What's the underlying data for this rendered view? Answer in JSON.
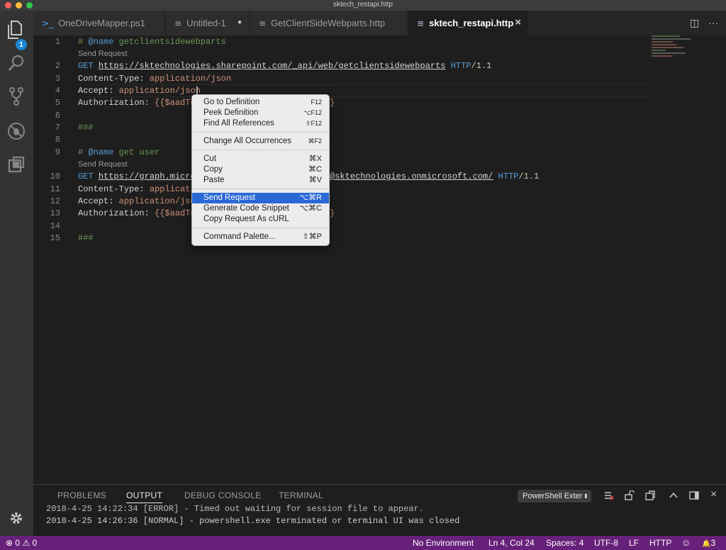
{
  "window": {
    "title": "sktech_restapi.http"
  },
  "activity": {
    "explorer_badge": "1"
  },
  "tabs": [
    {
      "label": "OneDriveMapper.ps1",
      "icon": "powershell-file-icon"
    },
    {
      "label": "Untitled-1",
      "icon": "file-icon",
      "dirty": true
    },
    {
      "label": "GetClientSideWebparts.http",
      "icon": "file-icon"
    },
    {
      "label": "sktech_restapi.http",
      "icon": "file-icon",
      "active": true
    }
  ],
  "glyphs": {
    "ps": ">_",
    "doc": "≡",
    "dot": "●",
    "close": "×",
    "split": "◫",
    "more": "···"
  },
  "editor": {
    "code_lens": "Send Request",
    "lines": {
      "l1": {
        "num": "1",
        "hash": "#",
        "tag": "@name",
        "name": "getclientsidewebparts"
      },
      "l2": {
        "num": "2",
        "method": "GET",
        "url": "https://sktechnologies.sharepoint.com/_api/web/getclientsidewebparts",
        "proto": "HTTP",
        "ver": "/1.1"
      },
      "l3": {
        "num": "3",
        "key": "Content-Type:",
        "val": "application/json"
      },
      "l4": {
        "num": "4",
        "key": "Accept:",
        "val": "application/json"
      },
      "l5": {
        "num": "5",
        "key": "Authorization:",
        "val_start": "{{$aadTo",
        "val_end": "}"
      },
      "l6": {
        "num": "6"
      },
      "l7": {
        "num": "7",
        "text": "###"
      },
      "l8": {
        "num": "8"
      },
      "l9": {
        "num": "9",
        "hash": "#",
        "tag": "@name",
        "name": "get user"
      },
      "l10": {
        "num": "10",
        "method": "GET",
        "url_start": "https://graph.micro",
        "url_end": "@sktechnologies.onmicrosoft.com/",
        "proto": "HTTP",
        "ver": "/1.1"
      },
      "l11": {
        "num": "11",
        "key": "Content-Type:",
        "val": "applicati"
      },
      "l12": {
        "num": "12",
        "key": "Accept:",
        "val": "application/jso"
      },
      "l13": {
        "num": "13",
        "key": "Authorization:",
        "val_start": "{{$aadTo",
        "val_end": "}"
      },
      "l14": {
        "num": "14"
      },
      "l15": {
        "num": "15",
        "text": "###"
      }
    }
  },
  "context_menu": {
    "items": [
      {
        "label": "Go to Definition",
        "shortcut": "F12"
      },
      {
        "label": "Peek Definition",
        "shortcut": "⌥F12"
      },
      {
        "label": "Find All References",
        "shortcut": "⇧F12"
      },
      {
        "label": "Change All Occurrences",
        "shortcut": "⌘F2"
      },
      {
        "label": "Cut",
        "shortcut": "⌘X"
      },
      {
        "label": "Copy",
        "shortcut": "⌘C"
      },
      {
        "label": "Paste",
        "shortcut": "⌘V"
      },
      {
        "label": "Send Request",
        "shortcut": "⌥⌘R",
        "highlighted": true
      },
      {
        "label": "Generate Code Snippet",
        "shortcut": "⌥⌘C"
      },
      {
        "label": "Copy Request As cURL",
        "shortcut": ""
      },
      {
        "label": "Command Palette...",
        "shortcut": "⇧⌘P"
      }
    ]
  },
  "panel": {
    "tabs": [
      "PROBLEMS",
      "OUTPUT",
      "DEBUG CONSOLE",
      "TERMINAL"
    ],
    "active_tab": "OUTPUT",
    "output_channel": "PowerShell Exter",
    "select_arrow": "⬍",
    "output_lines": [
      "2018-4-25 14:22:34 [ERROR] - Timed out waiting for session file to appear.",
      "2018-4-25 14:26:36 [NORMAL] - powershell.exe terminated or terminal UI was closed"
    ]
  },
  "status": {
    "errors": "0",
    "warnings": "0",
    "environment": "No Environment",
    "position": "Ln 4, Col 24",
    "spaces": "Spaces: 4",
    "encoding": "UTF-8",
    "eol": "LF",
    "language": "HTTP",
    "notifications": "3",
    "error_glyph": "⊗",
    "warning_glyph": "⚠",
    "smiley_glyph": "☺",
    "bell_glyph": "🔔"
  },
  "colors": {
    "accent": "#1a85d4",
    "statusbar": "#68217a",
    "menu_highlight": "#2a68d6"
  }
}
